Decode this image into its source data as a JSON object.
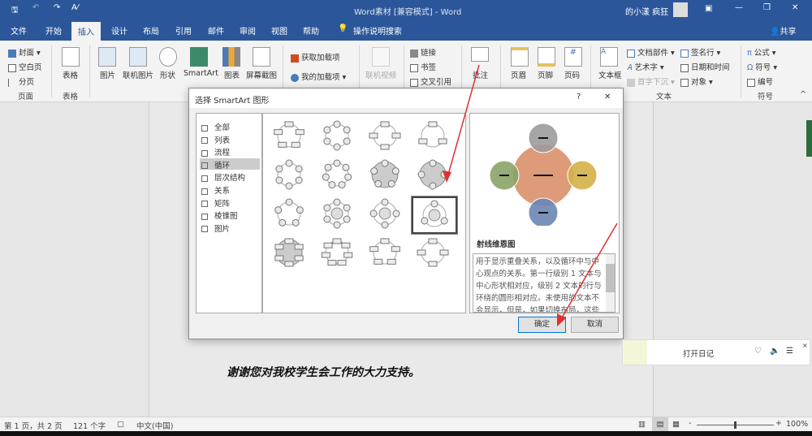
{
  "window": {
    "title": "Word素材 [兼容模式] - Word",
    "user": "的小漾 疯狂",
    "share": "共享"
  },
  "tabs": [
    "文件",
    "开始",
    "插入",
    "设计",
    "布局",
    "引用",
    "邮件",
    "审阅",
    "视图",
    "帮助"
  ],
  "active_tab": "插入",
  "tell_me": "操作说明搜索",
  "ribbon": {
    "pages": {
      "cover": "封面",
      "blank": "空白页",
      "break": "分页",
      "group": "页面"
    },
    "table": {
      "label": "表格",
      "group": "表格"
    },
    "illustrations": {
      "pictures": "图片",
      "online_pictures": "联机图片",
      "shapes": "形状",
      "smartart": "SmartArt",
      "chart": "图表",
      "screenshot": "屏幕截图",
      "group": "插图"
    },
    "addins": {
      "get": "获取加载项",
      "mine": "我的加载项"
    },
    "media": {
      "online_video": "联机视频"
    },
    "links": {
      "link": "链接",
      "bookmark": "书签",
      "cross_ref": "交叉引用"
    },
    "comment": "批注",
    "header_footer": {
      "header": "页眉",
      "footer": "页脚",
      "page_number": "页码"
    },
    "text": {
      "textbox": "文本框",
      "quick_parts": "文档部件",
      "wordart": "艺术字",
      "dropcap": "首字下沉",
      "signature": "签名行",
      "datetime": "日期和时间",
      "object": "对象",
      "group": "文本"
    },
    "symbols": {
      "equation": "公式",
      "symbol": "符号",
      "number": "编号",
      "group": "符号"
    }
  },
  "dialog": {
    "title": "选择 SmartArt 图形",
    "help": "?",
    "close": "✕",
    "categories": [
      "全部",
      "列表",
      "流程",
      "循环",
      "层次结构",
      "关系",
      "矩阵",
      "棱锥图",
      "图片"
    ],
    "selected_category": "循环",
    "preview_title": "射线维恩图",
    "description": "用于显示重叠关系，以及循环中与中心观点的关系。第一行级别 1 文本与中心形状相对应，级别 2 文本的行与环绕的圆形相对应。未使用的文本不会显示，但是，如果切换布局，这些文本仍将可用。",
    "ok": "确定",
    "cancel": "取消",
    "preview_colors": {
      "center": "#d9906c",
      "top": "#9b9b9b",
      "left": "#8aa368",
      "right": "#d4b048",
      "bottom": "#6a86b4"
    }
  },
  "document": {
    "line": "谢谢您对我校学生会工作的大力支持。"
  },
  "notification": {
    "text": "打开日记"
  },
  "status": {
    "page": "第 1 页，共 2 页",
    "words": "121 个字",
    "language": "中文(中国)",
    "zoom": "100%"
  }
}
